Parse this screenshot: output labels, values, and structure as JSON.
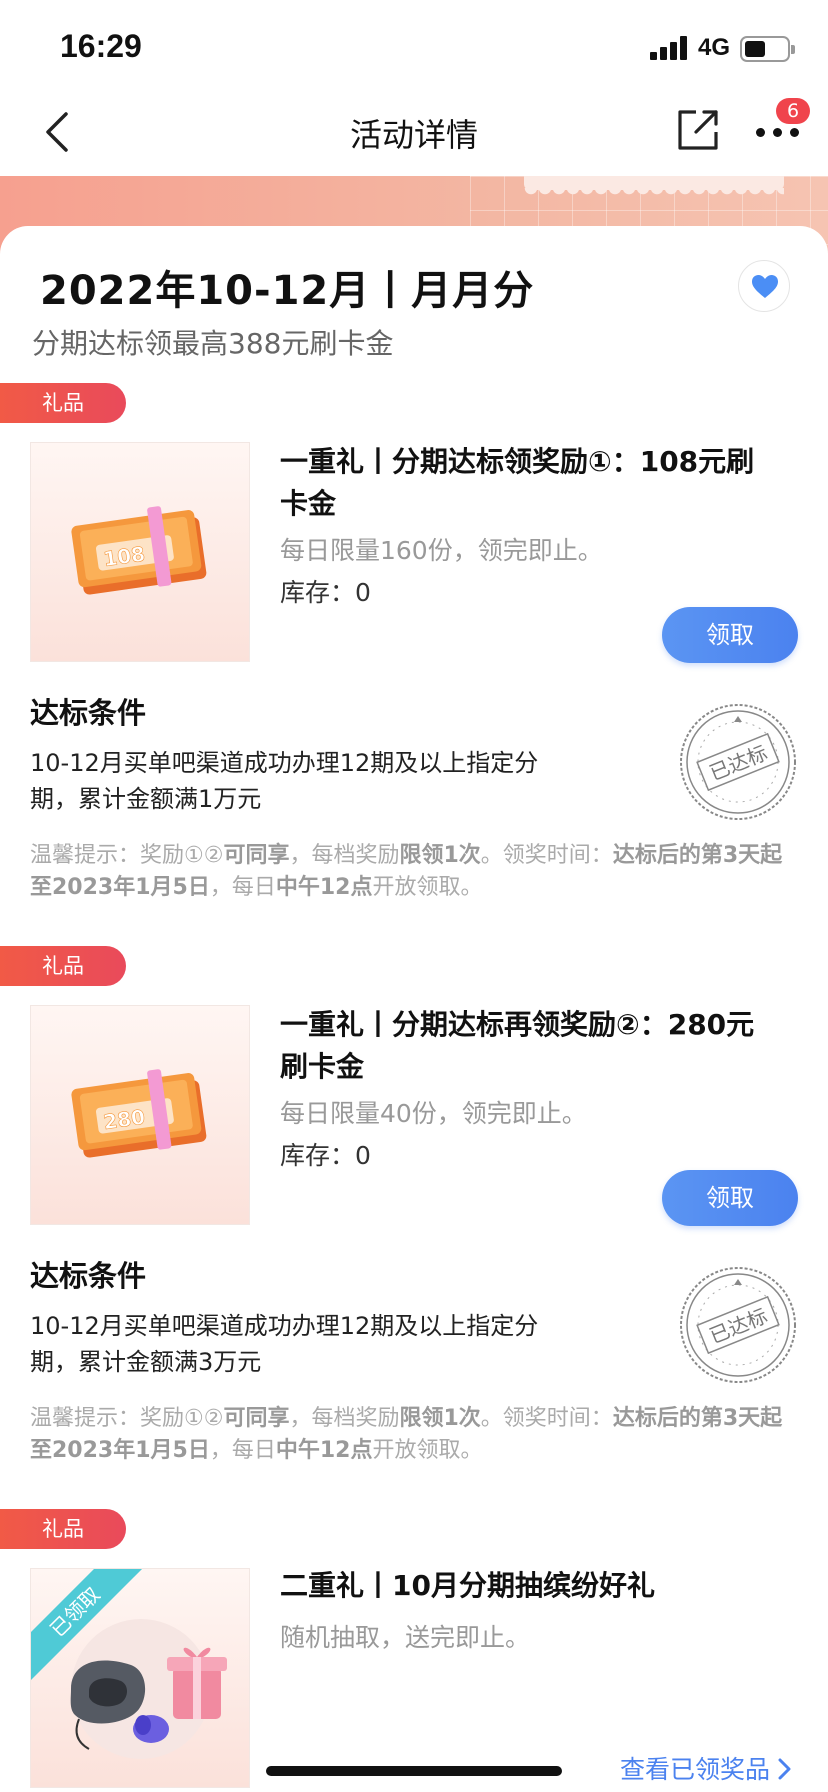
{
  "status_bar": {
    "time": "16:29",
    "network": "4G"
  },
  "nav": {
    "title": "活动详情",
    "badge_count": "6"
  },
  "activity": {
    "title": "2022年10-12月丨月月分",
    "subtitle": "分期达标领最高388元刷卡金"
  },
  "gifts": [
    {
      "tag": "礼品",
      "image_label": "108",
      "name": "一重礼丨分期达标领奖励①：108元刷卡金",
      "limit": "每日限量160份，领完即止。",
      "stock": "库存：0",
      "button": "领取",
      "condition_title": "达标条件",
      "condition_text": "10-12月买单吧渠道成功办理12期及以上指定分期，累计金额满1万元",
      "stamp": "已达标",
      "tips": {
        "prefix": "温馨提示：奖励①②",
        "b1": "可同享",
        "t2": "，每档奖励",
        "b2": "限领1次",
        "t3": "。领奖时间：",
        "b3": "达标后的第3天起至2023年1月5日",
        "t4": "，每日",
        "b4": "中午12点",
        "t5": "开放领取。"
      }
    },
    {
      "tag": "礼品",
      "image_label": "280",
      "name": "一重礼丨分期达标再领奖励②：280元刷卡金",
      "limit": "每日限量40份，领完即止。",
      "stock": "库存：0",
      "button": "领取",
      "condition_title": "达标条件",
      "condition_text": "10-12月买单吧渠道成功办理12期及以上指定分期，累计金额满3万元",
      "stamp": "已达标",
      "tips": {
        "prefix": "温馨提示：奖励①②",
        "b1": "可同享",
        "t2": "，每档奖励",
        "b2": "限领1次",
        "t3": "。领奖时间：",
        "b3": "达标后的第3天起至2023年1月5日",
        "t4": "，每日",
        "b4": "中午12点",
        "t5": "开放领取。"
      }
    },
    {
      "tag": "礼品",
      "ribbon": "已领取",
      "name": "二重礼丨10月分期抽缤纷好礼",
      "limit": "随机抽取，送完即止。"
    }
  ],
  "footer": {
    "view_prizes": "查看已领奖品"
  }
}
